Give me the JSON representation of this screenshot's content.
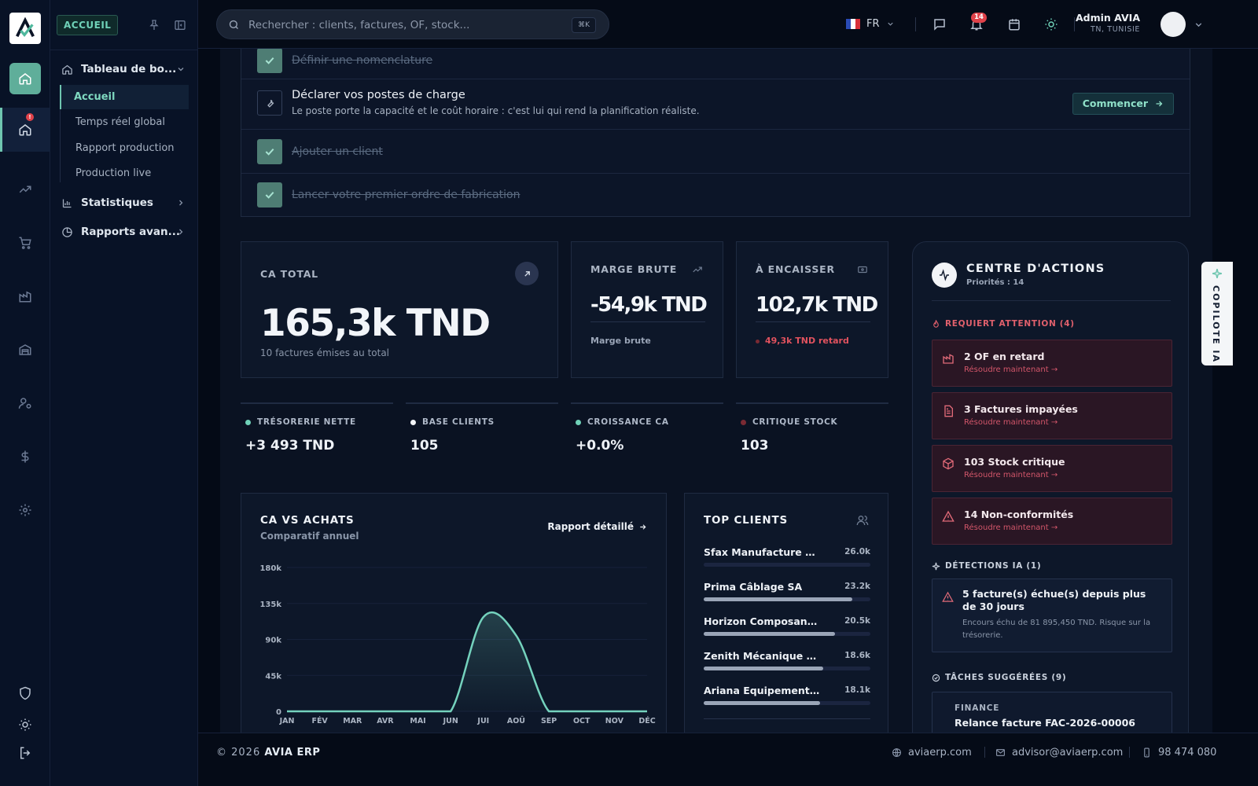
{
  "brand": {
    "logo_letter": "A"
  },
  "rail": {
    "notification_badge": "!",
    "icons": [
      "home-icon",
      "dashboard-icon",
      "trend-icon",
      "cart-icon",
      "factory-icon",
      "warehouse-icon",
      "users-icon",
      "dollar-icon",
      "settings-icon",
      "shield-icon",
      "theme-icon",
      "logout-icon"
    ]
  },
  "sidebar": {
    "chip": "ACCUEIL",
    "groups": [
      {
        "label": "Tableau de bo...",
        "icon": "home-icon",
        "expanded": true,
        "items": [
          "Accueil",
          "Temps réel global",
          "Rapport production",
          "Production live"
        ]
      },
      {
        "label": "Statistiques",
        "icon": "bar-chart-icon"
      },
      {
        "label": "Rapports avan...",
        "icon": "pie-chart-icon"
      }
    ]
  },
  "header": {
    "search_placeholder": "Rechercher : clients, factures, OF, stock...",
    "shortcut": "⌘K",
    "language": "FR",
    "notifications_count": "14",
    "user_name": "Admin AVIA",
    "user_location": "TN, TUNISIE"
  },
  "onboarding": {
    "steps": [
      {
        "label": "Définir une nomenclature",
        "done": true
      },
      {
        "label": "Déclarer vos postes de charge",
        "done": false,
        "desc": "Le poste porte la capacité et le coût horaire : c'est lui qui rend la planification réaliste.",
        "cta": "Commencer"
      },
      {
        "label": "Ajouter un client",
        "done": true
      },
      {
        "label": "Lancer votre premier ordre de fabrication",
        "done": true
      }
    ]
  },
  "kpis": {
    "ca_total": {
      "label": "CA TOTAL",
      "value": "165,3k TND",
      "note": "10 factures émises au total"
    },
    "marge": {
      "label": "MARGE BRUTE",
      "value": "-54,9k TND",
      "note": "Marge brute"
    },
    "encaisser": {
      "label": "À ENCAISSER",
      "value": "102,7k TND",
      "note": "49,3k TND retard"
    }
  },
  "stats": [
    {
      "label": "TRÉSORERIE NETTE",
      "value": "+3 493 TND",
      "color": "#6fd1b8"
    },
    {
      "label": "BASE CLIENTS",
      "value": "105",
      "color": "#f2f4f7"
    },
    {
      "label": "CROISSANCE CA",
      "value": "+0.0%",
      "color": "#6fd1b8"
    },
    {
      "label": "CRITIQUE STOCK",
      "value": "103",
      "color": "#7a2a33"
    }
  ],
  "ca_chart": {
    "title": "CA VS ACHATS",
    "subtitle": "Comparatif annuel",
    "link": "Rapport détaillé",
    "chart_data": {
      "type": "area",
      "categories": [
        "JAN",
        "FÉV",
        "MAR",
        "AVR",
        "MAI",
        "JUN",
        "JUI",
        "AOÛ",
        "SEP",
        "OCT",
        "NOV",
        "DÉC"
      ],
      "series": [
        {
          "values": [
            0,
            0,
            0,
            0,
            0,
            0,
            118000,
            95000,
            0,
            0,
            0,
            0
          ]
        }
      ],
      "yticks": [
        "0",
        "45k",
        "90k",
        "135k",
        "180k"
      ],
      "ylim": [
        0,
        180000
      ],
      "color": "#74d2bd"
    }
  },
  "top_clients": {
    "title": "TOP CLIENTS",
    "max": 26.0,
    "items": [
      {
        "name": "Sfax Manufacture EURL",
        "value": "26.0k",
        "num": 26.0
      },
      {
        "name": "Prima Câblage SA",
        "value": "23.2k",
        "num": 23.2
      },
      {
        "name": "Horizon Composants ...",
        "value": "20.5k",
        "num": 20.5
      },
      {
        "name": "Zenith Mécanique SARL",
        "value": "18.6k",
        "num": 18.6
      },
      {
        "name": "Ariana Equipements S...",
        "value": "18.1k",
        "num": 18.1
      }
    ]
  },
  "action_center": {
    "title": "CENTRE D'ACTIONS",
    "subtitle": "Priorités : 14",
    "attention_label": "REQUIERT ATTENTION (4)",
    "alerts": [
      {
        "title": "2 OF en retard",
        "link": "Résoudre maintenant →",
        "icon": "factory-icon"
      },
      {
        "title": "3 Factures impayées",
        "link": "Résoudre maintenant →",
        "icon": "invoice-icon"
      },
      {
        "title": "103 Stock critique",
        "link": "Résoudre maintenant →",
        "icon": "box-icon"
      },
      {
        "title": "14 Non-conformités",
        "link": "Résoudre maintenant →",
        "icon": "warning-icon"
      }
    ],
    "ia_label": "DÉTECTIONS IA (1)",
    "ia": {
      "title": "5 facture(s) échue(s) depuis plus de 30 jours",
      "desc": "Encours échu de 81 895,450 TND. Risque sur la trésorerie."
    },
    "tasks_label": "TÂCHES SUGGÉRÉES (9)",
    "task": {
      "category": "FINANCE",
      "title": "Relance facture FAC-2026-00006"
    }
  },
  "copilot": {
    "label": "COPILOTE IA"
  },
  "footer": {
    "copyright": "© 2026",
    "brand": "AVIA ERP",
    "website": "aviaerp.com",
    "email": "advisor@aviaerp.com",
    "phone": "98 474 080"
  }
}
